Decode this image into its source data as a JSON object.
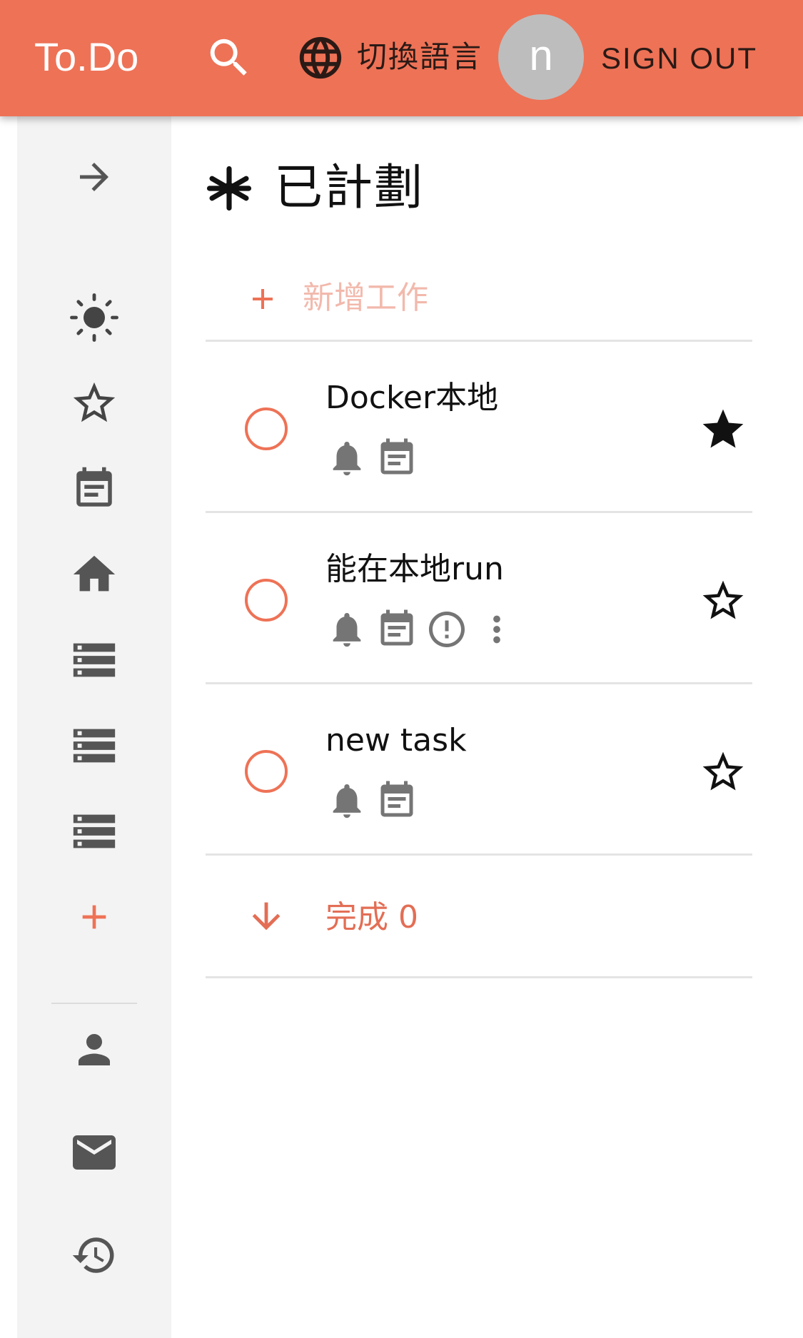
{
  "appbar": {
    "brand": "To.Do",
    "language_label": "切換語言",
    "avatar_initial": "n",
    "signout_label": "SIGN OUT",
    "color": "#EE7256"
  },
  "sidebar": {
    "items": [
      {
        "icon": "arrow-right-icon"
      },
      {
        "icon": "sun-icon"
      },
      {
        "icon": "star-outline-icon"
      },
      {
        "icon": "calendar-icon"
      },
      {
        "icon": "home-icon"
      },
      {
        "icon": "storage-icon"
      },
      {
        "icon": "storage-icon"
      },
      {
        "icon": "storage-icon"
      },
      {
        "icon": "plus-icon"
      },
      {
        "icon": "person-icon"
      },
      {
        "icon": "mail-icon"
      },
      {
        "icon": "history-icon"
      }
    ]
  },
  "main": {
    "title": "已計劃",
    "title_icon": "asterisk-icon",
    "add_task_placeholder": "新增工作",
    "tasks": [
      {
        "title": "Docker本地",
        "starred": true,
        "icons": [
          "bell-icon",
          "calendar-icon"
        ]
      },
      {
        "title": "能在本地run",
        "starred": false,
        "icons": [
          "bell-icon",
          "calendar-icon",
          "important-icon",
          "more-vert-icon"
        ]
      },
      {
        "title": "new task",
        "starred": false,
        "icons": [
          "bell-icon",
          "calendar-icon"
        ]
      }
    ],
    "completed_label": "完成 0"
  }
}
